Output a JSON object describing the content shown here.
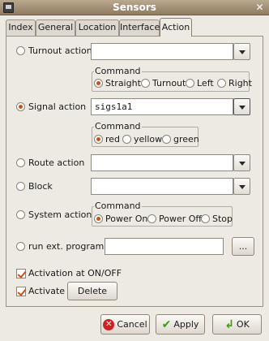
{
  "window": {
    "title": "Sensors",
    "close_glyph": "✕"
  },
  "tabs": [
    {
      "label": "Index"
    },
    {
      "label": "General"
    },
    {
      "label": "Location"
    },
    {
      "label": "Interface"
    },
    {
      "label": "Action"
    }
  ],
  "active_tab": "Action",
  "turnout": {
    "label": "Turnout action",
    "value": "",
    "command_title": "Command",
    "options": [
      "Straight",
      "Turnout",
      "Left",
      "Right"
    ],
    "selected": "Straight"
  },
  "signal": {
    "label": "Signal action",
    "value": "sigs1a1",
    "command_title": "Command",
    "options": [
      "red",
      "yellow",
      "green"
    ],
    "selected": "red"
  },
  "route": {
    "label": "Route action",
    "value": ""
  },
  "block": {
    "label": "Block",
    "value": ""
  },
  "system": {
    "label": "System action",
    "command_title": "Command",
    "options": [
      "Power On",
      "Power Off",
      "Stop"
    ],
    "selected": "Power On"
  },
  "program": {
    "label": "run ext. program.",
    "value": "",
    "browse_label": "..."
  },
  "activation_onoff": {
    "label": "Activation at ON/OFF",
    "checked": true
  },
  "activate": {
    "label": "Activate",
    "checked": true
  },
  "delete_label": "Delete",
  "footer": {
    "cancel_label": "Cancel",
    "apply_label": "Apply",
    "ok_label": "OK"
  },
  "selected_action": "Signal action",
  "colors": {
    "accent": "#d24f14",
    "titlebar": "#a08c70",
    "ok_green": "#3f9a12",
    "cancel_red": "#d01f1f"
  }
}
